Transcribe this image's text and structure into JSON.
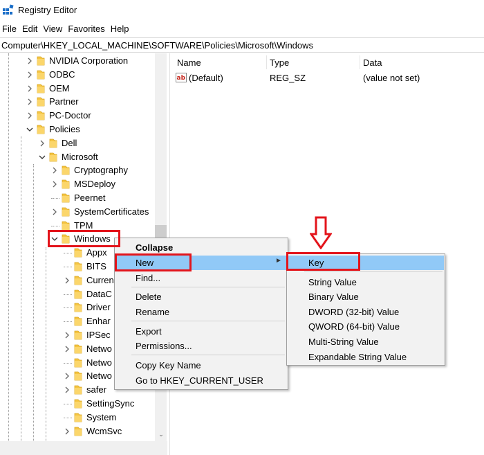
{
  "window": {
    "title": "Registry Editor"
  },
  "menubar": [
    "File",
    "Edit",
    "View",
    "Favorites",
    "Help"
  ],
  "address": "Computer\\HKEY_LOCAL_MACHINE\\SOFTWARE\\Policies\\Microsoft\\Windows",
  "tree": {
    "items": [
      {
        "label": "NVIDIA Corporation",
        "expanded": false
      },
      {
        "label": "ODBC",
        "expanded": false
      },
      {
        "label": "OEM",
        "expanded": false
      },
      {
        "label": "Partner",
        "expanded": false
      },
      {
        "label": "PC-Doctor",
        "expanded": false
      },
      {
        "label": "Policies",
        "expanded": true
      },
      {
        "label": "Dell",
        "expanded": false
      },
      {
        "label": "Microsoft",
        "expanded": true
      },
      {
        "label": "Cryptography",
        "expanded": false
      },
      {
        "label": "MSDeploy",
        "expanded": false
      },
      {
        "label": "Peernet",
        "expanded": null
      },
      {
        "label": "SystemCertificates",
        "expanded": false
      },
      {
        "label": "TPM",
        "expanded": null
      },
      {
        "label": "Windows",
        "expanded": true
      },
      {
        "label": "Appx",
        "expanded": null
      },
      {
        "label": "BITS",
        "expanded": null
      },
      {
        "label": "Curren",
        "expanded": false
      },
      {
        "label": "DataC",
        "expanded": null
      },
      {
        "label": "Driver",
        "expanded": null
      },
      {
        "label": "Enhar",
        "expanded": null
      },
      {
        "label": "IPSec",
        "expanded": false
      },
      {
        "label": "Netwo",
        "expanded": false
      },
      {
        "label": "Netwo",
        "expanded": null
      },
      {
        "label": "Netwo",
        "expanded": false
      },
      {
        "label": "safer",
        "expanded": false
      },
      {
        "label": "SettingSync",
        "expanded": null
      },
      {
        "label": "System",
        "expanded": null
      },
      {
        "label": "WcmSvc",
        "expanded": false
      }
    ]
  },
  "list": {
    "columns": [
      "Name",
      "Type",
      "Data"
    ],
    "rows": [
      {
        "name": "(Default)",
        "type": "REG_SZ",
        "data": "(value not set)"
      }
    ]
  },
  "context_menu": {
    "items": [
      "Collapse",
      "New",
      "Find...",
      "Delete",
      "Rename",
      "Export",
      "Permissions...",
      "Copy Key Name",
      "Go to HKEY_CURRENT_USER"
    ],
    "highlighted": "New"
  },
  "submenu": {
    "items": [
      "Key",
      "String Value",
      "Binary Value",
      "DWORD (32-bit) Value",
      "QWORD (64-bit) Value",
      "Multi-String Value",
      "Expandable String Value"
    ],
    "highlighted": "Key"
  },
  "colors": {
    "highlight": "#91c9f7",
    "annotation_red": "#e3141b",
    "folder": "#f5c542"
  }
}
